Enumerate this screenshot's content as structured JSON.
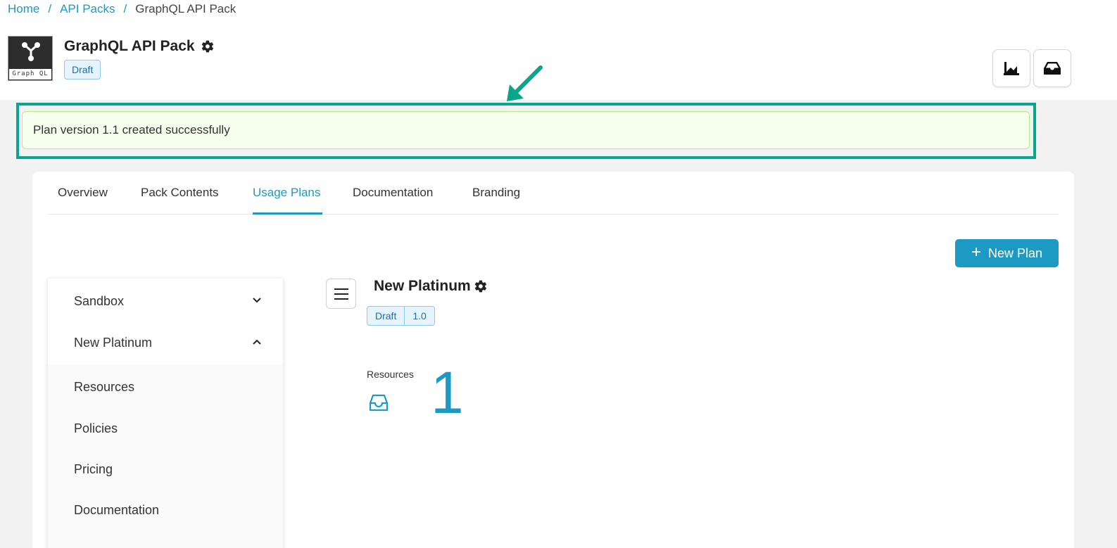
{
  "breadcrumb": {
    "home": "Home",
    "sep": "/",
    "api_packs": "API Packs",
    "current": "GraphQL API Pack"
  },
  "logo": {
    "text": "Graph QL"
  },
  "pack": {
    "title": "GraphQL API Pack",
    "status": "Draft"
  },
  "header_actions": {
    "analytics_icon": "factory-chart-icon",
    "inbox_icon": "inbox-icon"
  },
  "alert": {
    "message": "Plan version 1.1 created successfully"
  },
  "tabs": [
    {
      "label": "Overview"
    },
    {
      "label": "Pack Contents"
    },
    {
      "label": "Usage Plans",
      "active": true
    },
    {
      "label": "Documentation"
    },
    {
      "label": "Branding"
    }
  ],
  "new_plan_button": {
    "plus": "+",
    "label": "New Plan"
  },
  "sidenav": {
    "plans": [
      {
        "label": "Sandbox",
        "expanded": false
      },
      {
        "label": "New Platinum",
        "expanded": true
      }
    ],
    "sub_items": [
      {
        "label": "Resources"
      },
      {
        "label": "Policies"
      },
      {
        "label": "Pricing"
      },
      {
        "label": "Documentation"
      }
    ]
  },
  "plan": {
    "title": "New Platinum",
    "status": "Draft",
    "version": "1.0",
    "resources_label": "Resources",
    "resources_count": "1"
  },
  "colors": {
    "accent": "#1c9ac4",
    "highlight": "#0aa58a",
    "alert_bg": "#f6ffed"
  }
}
